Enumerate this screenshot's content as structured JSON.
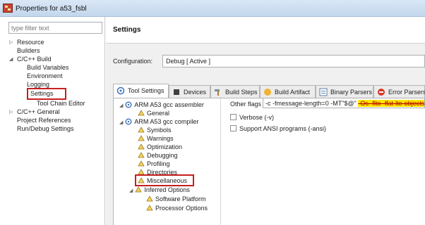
{
  "window": {
    "title": "Properties for a53_fsbl"
  },
  "filter": {
    "placeholder": "type filter text"
  },
  "nav_tree": {
    "resource": "Resource",
    "builders": "Builders",
    "cpp_build": "C/C++ Build",
    "build_variables": "Build Variables",
    "environment": "Environment",
    "logging": "Logging",
    "settings": "Settings",
    "tool_chain_editor": "Tool Chain Editor",
    "cpp_general": "C/C++ General",
    "project_references": "Project References",
    "run_debug_settings": "Run/Debug Settings"
  },
  "page": {
    "title": "Settings",
    "configuration_label": "Configuration:",
    "configuration_value": "Debug  [ Active ]"
  },
  "tabs": {
    "tool_settings": "Tool Settings",
    "devices": "Devices",
    "build_steps": "Build Steps",
    "build_artifact": "Build Artifact",
    "binary_parsers": "Binary Parsers",
    "error_parsers": "Error Parsers"
  },
  "tool_tree": {
    "assembler": "ARM A53 gcc assembler",
    "assembler_general": "General",
    "compiler": "ARM A53 gcc compiler",
    "symbols": "Symbols",
    "warnings": "Warnings",
    "optimization": "Optimization",
    "debugging": "Debugging",
    "profiling": "Profiling",
    "directories": "Directories",
    "miscellaneous": "Miscellaneous",
    "inferred_options": "Inferred Options",
    "software_platform": "Software Platform",
    "processor_options": "Processor Options"
  },
  "options": {
    "other_flags_label": "Other flags",
    "other_flags_value": "-c -fmessage-length=0 -MT\"$@\"",
    "other_flags_struck": "-Os -flto -ffat-lto-objects",
    "verbose_label": "Verbose (-v)",
    "ansi_label": "Support ANSI programs (-ansi)"
  },
  "colors": {
    "highlight_box": "#c81e1e",
    "strike_background": "#ffe500",
    "error_parsers_icon": "#d83a2a"
  }
}
